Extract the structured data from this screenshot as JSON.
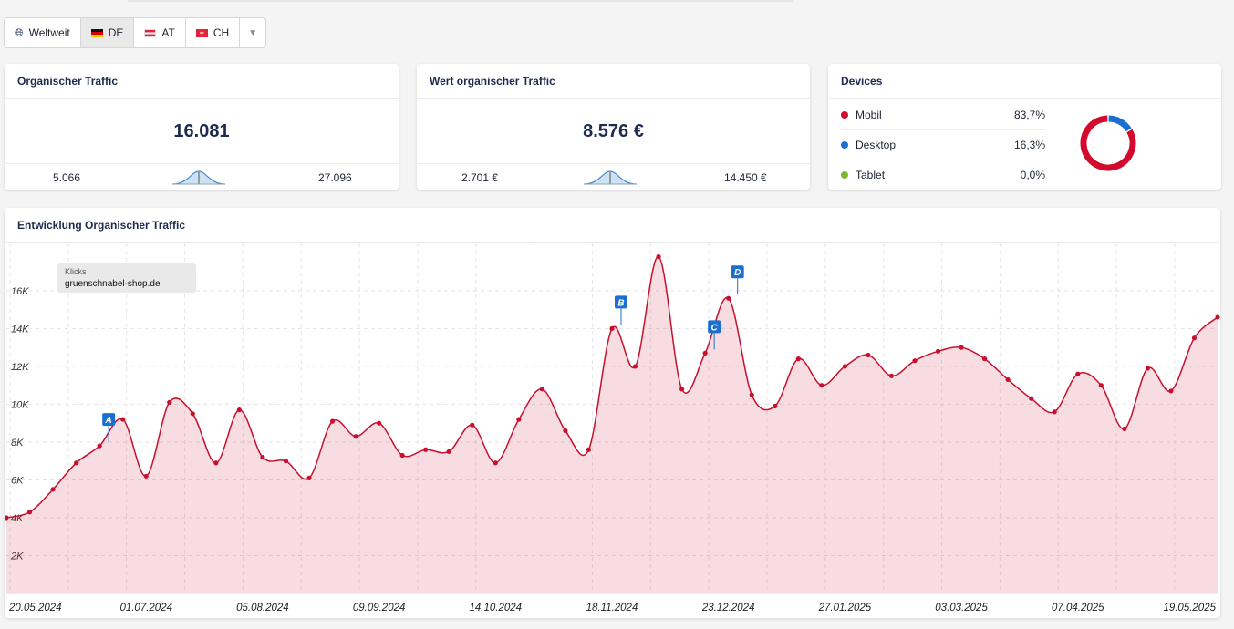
{
  "countries": [
    {
      "code": "world",
      "label": "Weltweit"
    },
    {
      "code": "de",
      "label": "DE"
    },
    {
      "code": "at",
      "label": "AT"
    },
    {
      "code": "ch",
      "label": "CH"
    }
  ],
  "kpi": {
    "traffic": {
      "title": "Organischer Traffic",
      "value": "16.081",
      "min": "5.066",
      "max": "27.096"
    },
    "wert": {
      "title": "Wert organischer Traffic",
      "value": "8.576 €",
      "min": "2.701 €",
      "max": "14.450 €"
    }
  },
  "devices": {
    "title": "Devices",
    "items": [
      {
        "label": "Mobil",
        "value": "83,7%",
        "color": "#d20a2e"
      },
      {
        "label": "Desktop",
        "value": "16,3%",
        "color": "#1a6fd0"
      },
      {
        "label": "Tablet",
        "value": "0,0%",
        "color": "#7cb82f"
      }
    ],
    "donut": [
      0.837,
      0.163,
      0.0
    ]
  },
  "chart_section": {
    "title": "Entwicklung Organischer Traffic"
  },
  "tooltip": {
    "label": "Klicks",
    "domain": "gruenschnabel-shop.de"
  },
  "chart_data": {
    "type": "area",
    "series": [
      {
        "values": [
          4.0,
          4.3,
          5.5,
          6.9,
          7.8,
          9.2,
          6.2,
          10.1,
          9.5,
          6.9,
          9.7,
          7.2,
          7.0,
          6.1,
          9.1,
          8.3,
          9.0,
          7.3,
          7.6,
          7.5,
          8.9,
          6.9,
          9.2,
          10.8,
          8.6,
          7.6,
          14.0,
          12.0,
          17.8,
          10.8,
          12.7,
          15.6,
          10.5,
          9.9,
          12.4,
          11.0,
          12.0,
          12.6,
          11.5,
          12.3,
          12.8,
          13.0,
          12.4,
          11.3,
          10.3,
          9.6,
          11.6,
          11.0,
          8.7,
          11.9,
          10.7,
          13.5,
          14.6
        ]
      }
    ],
    "x_tick_labels": [
      "20.05.2024",
      "01.07.2024",
      "05.08.2024",
      "09.09.2024",
      "14.10.2024",
      "18.11.2024",
      "23.12.2024",
      "27.01.2025",
      "03.03.2025",
      "07.04.2025",
      "19.05.2025"
    ],
    "x_tick_index": [
      0,
      6,
      11,
      16,
      21,
      26,
      31,
      36,
      41,
      46,
      52
    ],
    "y_tick_labels": [
      "2K",
      "4K",
      "6K",
      "8K",
      "10K",
      "12K",
      "14K",
      "16K"
    ],
    "ylim": [
      0,
      18.5
    ],
    "markers": [
      {
        "label": "A",
        "index": 4
      },
      {
        "label": "B",
        "index": 26
      },
      {
        "label": "C",
        "index": 30
      },
      {
        "label": "D",
        "index": 31
      }
    ],
    "grid": true,
    "color": "#c8102e"
  }
}
